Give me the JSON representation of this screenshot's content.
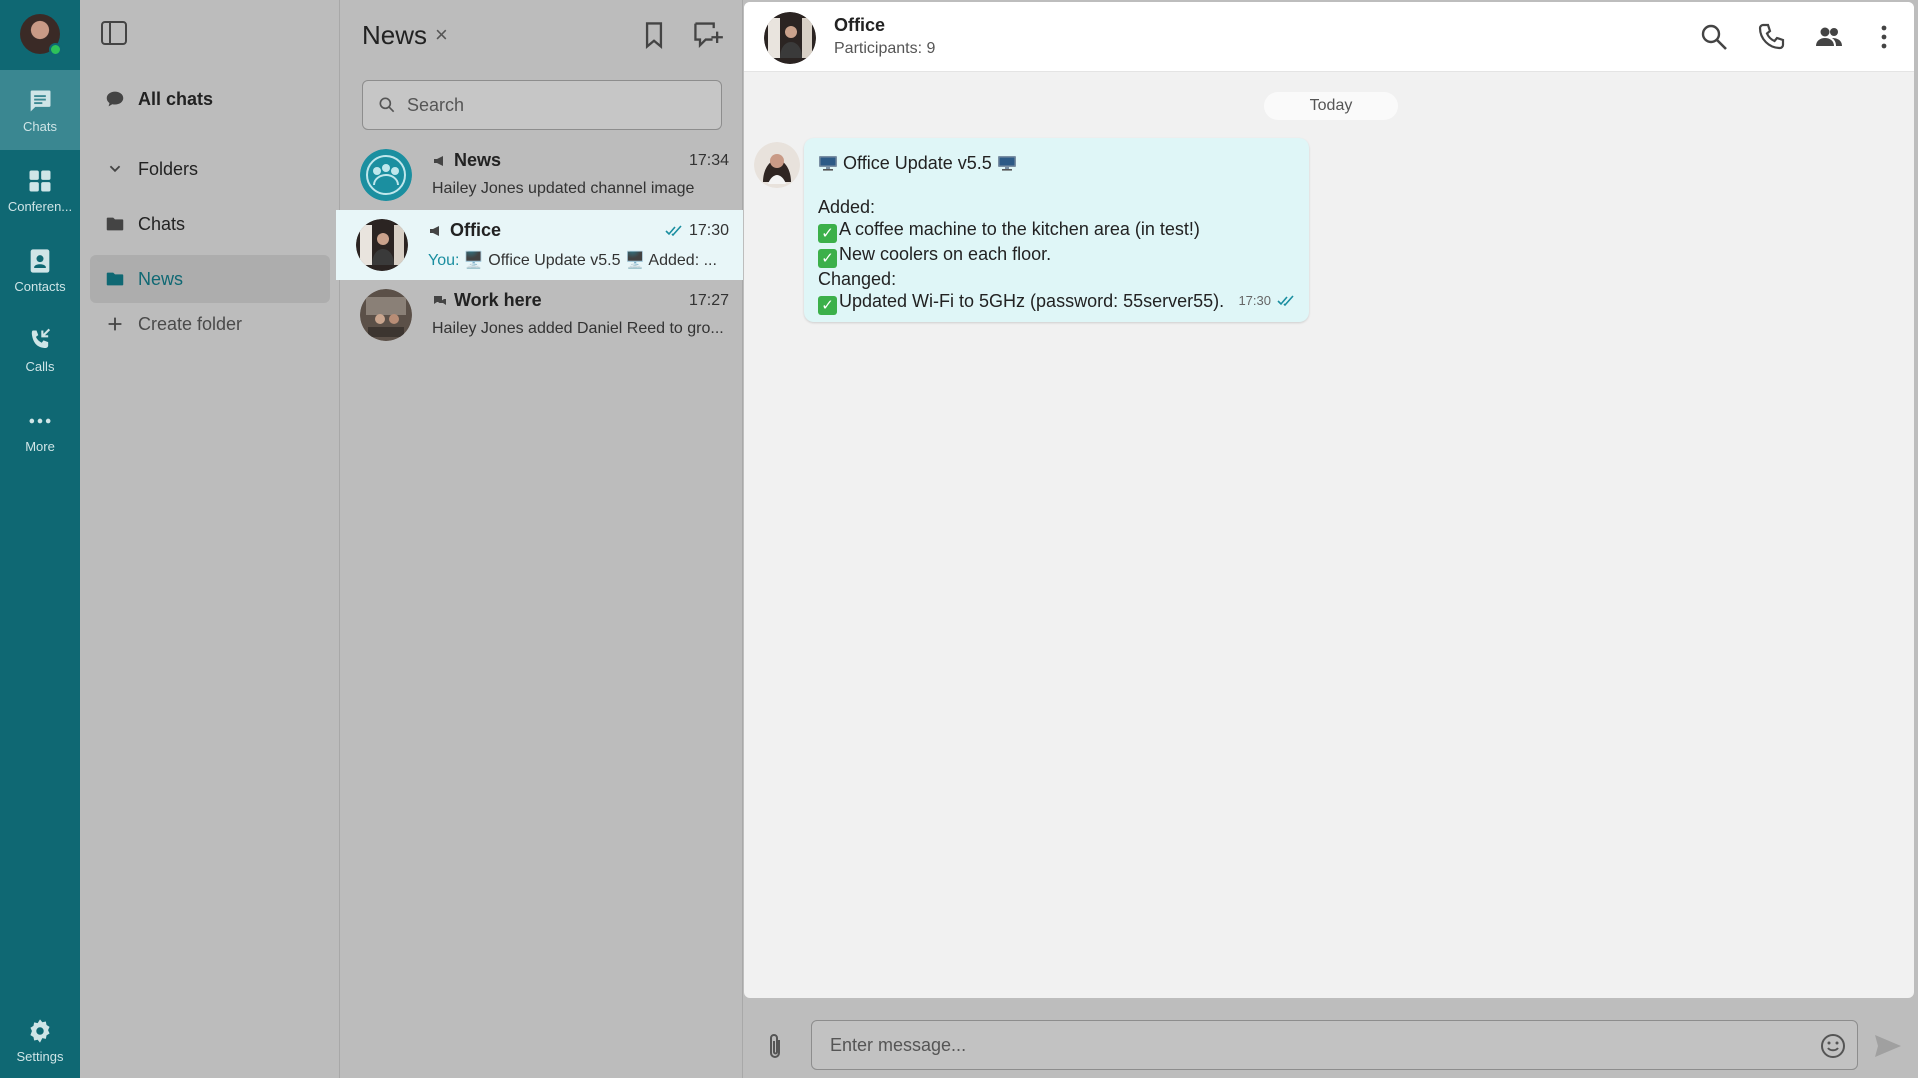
{
  "rail": {
    "items": [
      {
        "label": "Chats",
        "icon": "chat-bubble-icon",
        "active": true
      },
      {
        "label": "Conferen...",
        "icon": "conference-icon"
      },
      {
        "label": "Contacts",
        "icon": "contacts-icon"
      },
      {
        "label": "Calls",
        "icon": "calls-icon"
      },
      {
        "label": "More",
        "icon": "more-dots-icon"
      }
    ],
    "settings_label": "Settings"
  },
  "folders": {
    "all_chats": "All chats",
    "folders_label": "Folders",
    "chats": "Chats",
    "news": "News",
    "create_folder": "Create folder"
  },
  "list": {
    "title": "News",
    "close_glyph": "×",
    "search_placeholder": "Search",
    "rows": [
      {
        "name": "News",
        "time": "17:34",
        "preview": "Hailey Jones updated channel image",
        "type_icon": "channel-icon"
      },
      {
        "name": "Office",
        "time": "17:30",
        "you": "You:",
        "preview": "🖥️ Office Update v5.5 🖥️  Added: ...",
        "type_icon": "channel-icon",
        "read": true,
        "active": true
      },
      {
        "name": "Work here",
        "time": "17:27",
        "preview": "Hailey Jones added Daniel Reed to gro...",
        "type_icon": "group-icon"
      }
    ]
  },
  "conversation": {
    "title": "Office",
    "subtitle": "Participants: 9",
    "day_label": "Today",
    "message": {
      "line1": "Office Update v5.5",
      "added": "Added:",
      "item1": "A coffee machine to the kitchen area (in test!)",
      "item2": "New coolers on each floor.",
      "changed": "Changed:",
      "item3": "Updated Wi-Fi to 5GHz (password: 55server55).",
      "time": "17:30"
    },
    "composer_placeholder": "Enter message..."
  },
  "colors": {
    "rail": "#0f6873",
    "accent": "#1a8ea0",
    "bubble": "#dff6f7"
  }
}
